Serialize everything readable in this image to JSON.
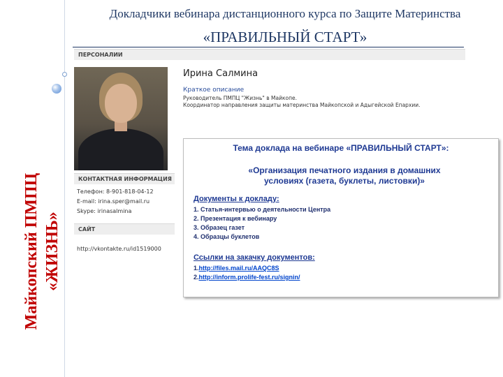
{
  "slide": {
    "title_line1": "Докладчики вебинара дистанционного курса по Защите Материнства",
    "title_line2": "«ПРАВИЛЬНЫЙ  СТАРТ»",
    "side_line1": "Майкопский  ПМПЦ",
    "side_line2": "«ЖИЗНЬ»"
  },
  "profile": {
    "section_title": "ПЕРСОНАЛИИ",
    "name": "Ирина Салмина",
    "brief_heading": "Краткое описание",
    "brief_line1": "Руководитель ПМПЦ \"Жизнь\" в Майкопе.",
    "brief_line2": "Координатор направления защиты материнства Майкопской и Адыгейской Епархии.",
    "contact_heading": "КОНТАКТНАЯ ИНФОРМАЦИЯ",
    "phone": "Телефон: 8-901-818-04-12",
    "email": "E-mail: irina.sper@mail.ru",
    "skype": "Skype: irinasalmina",
    "site_heading": "САЙТ",
    "site_url": "http://vkontakte.ru/id1519000"
  },
  "talk": {
    "heading": "Тема доклада на вебинаре «ПРАВИЛЬНЫЙ СТАРТ»:",
    "topic_line1": "«Организация печатного издания в домашних",
    "topic_line2": "условиях (газета, буклеты, листовки)»",
    "docs_heading": "Документы к докладу:",
    "docs": [
      "1. Статья-интервью о деятельности Центра",
      "2. Презентация к вебинару",
      "3. Образец газет",
      "4. Образцы буклетов"
    ],
    "links_heading": "Ссылки на закачку документов:",
    "links": [
      {
        "prefix": "1.",
        "url": "http://files.mail.ru/AAQC8S"
      },
      {
        "prefix": "2.",
        "url": "http://inform.prolife-fest.ru/signin/"
      }
    ]
  },
  "colors": {
    "title": "#1f3864",
    "side_text": "#c00000",
    "talk_text": "#1f3a93",
    "link": "#0044cc"
  }
}
